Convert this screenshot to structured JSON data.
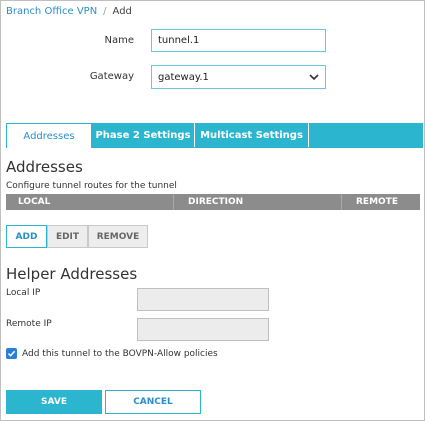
{
  "breadcrumb": {
    "parent": "Branch Office VPN",
    "separator": "/",
    "current": "Add"
  },
  "form": {
    "name_label": "Name",
    "name_value": "tunnel.1",
    "gateway_label": "Gateway",
    "gateway_value": "gateway.1"
  },
  "tabs": [
    {
      "label": "Addresses",
      "active": true
    },
    {
      "label": "Phase 2 Settings",
      "active": false
    },
    {
      "label": "Multicast Settings",
      "active": false
    }
  ],
  "addresses": {
    "title": "Addresses",
    "description": "Configure tunnel routes for the tunnel",
    "columns": [
      "LOCAL",
      "DIRECTION",
      "REMOTE"
    ],
    "buttons": {
      "add": "ADD",
      "edit": "EDIT",
      "remove": "REMOVE"
    }
  },
  "helper": {
    "title": "Helper Addresses",
    "local_ip_label": "Local IP",
    "local_ip_value": "",
    "remote_ip_label": "Remote IP",
    "remote_ip_value": "",
    "policy_checkbox_label": "Add this tunnel to the BOVPN-Allow policies",
    "policy_checkbox_checked": true
  },
  "actions": {
    "save": "SAVE",
    "cancel": "CANCEL"
  },
  "colors": {
    "accent": "#2bb5cf",
    "link": "#2a8fc7",
    "table_header": "#8c8c8c",
    "checkbox": "#2a7fd4"
  },
  "icons": {
    "select_arrow": "chevron-down-icon",
    "checkbox": "checkmark-icon"
  }
}
